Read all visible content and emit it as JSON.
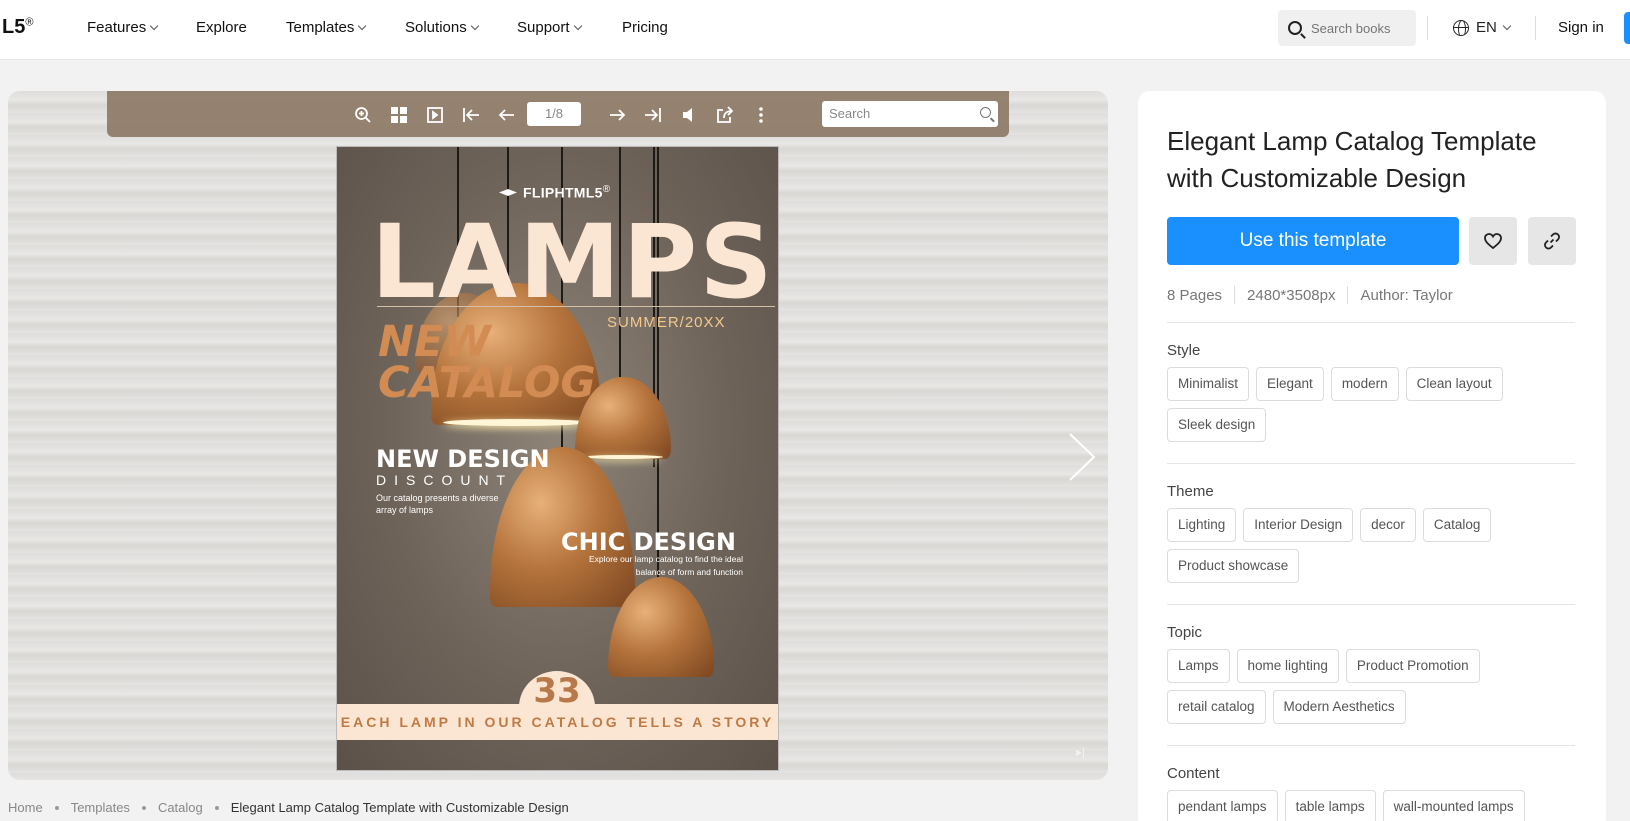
{
  "nav": {
    "logo": "L5",
    "logo_mark": "®",
    "items": [
      {
        "label": "Features",
        "dropdown": true
      },
      {
        "label": "Explore",
        "dropdown": false
      },
      {
        "label": "Templates",
        "dropdown": true
      },
      {
        "label": "Solutions",
        "dropdown": true
      },
      {
        "label": "Support",
        "dropdown": true
      },
      {
        "label": "Pricing",
        "dropdown": false
      }
    ],
    "search_placeholder": "Search books",
    "language": "EN",
    "signin": "Sign in"
  },
  "viewer": {
    "page_indicator": "1/8",
    "search_placeholder": "Search",
    "toolbar_icons": [
      "zoom-in-icon",
      "thumbnails-icon",
      "single-page-icon",
      "first-page-icon",
      "prev-page-icon",
      "next-page-icon",
      "last-page-icon",
      "sound-icon",
      "share-icon",
      "more-icon"
    ]
  },
  "cover": {
    "brand": "FLIPHTML5",
    "brand_mark": "®",
    "title": "LAMPS",
    "season": "SUMMER/20XX",
    "subtitle_line1": "NEW",
    "subtitle_line2": "CATALOG",
    "new_design": "NEW DESIGN",
    "discount": "DISCOUNT",
    "desc1": "Our catalog presents a diverse array of lamps",
    "chic_design": "CHIC DESIGN",
    "desc2": "Explore our lamp catalog to find the ideal balance of form and function",
    "number": "33",
    "band_text": "EACH LAMP IN OUR CATALOG TELLS A STORY"
  },
  "breadcrumb": [
    "Home",
    "Templates",
    "Catalog",
    "Elegant Lamp Catalog Template with Customizable Design"
  ],
  "panel": {
    "title": "Elegant Lamp Catalog Template with Customizable Design",
    "use_button": "Use this template",
    "meta": [
      "8 Pages",
      "2480*3508px",
      "Author: Taylor"
    ],
    "sections": [
      {
        "title": "Style",
        "tags": [
          "Minimalist",
          "Elegant",
          "modern",
          "Clean layout",
          "Sleek design"
        ]
      },
      {
        "title": "Theme",
        "tags": [
          "Lighting",
          "Interior Design",
          "decor",
          "Catalog",
          "Product showcase"
        ]
      },
      {
        "title": "Topic",
        "tags": [
          "Lamps",
          "home lighting",
          "Product Promotion",
          "retail catalog",
          "Modern Aesthetics"
        ]
      },
      {
        "title": "Content",
        "tags": [
          "pendant lamps",
          "table lamps",
          "wall-mounted lamps"
        ]
      }
    ]
  },
  "colors": {
    "accent": "#1a90ff",
    "toolbar": "#8c7864",
    "cover_band": "#fbe6d3",
    "copper": "#b5743c"
  }
}
